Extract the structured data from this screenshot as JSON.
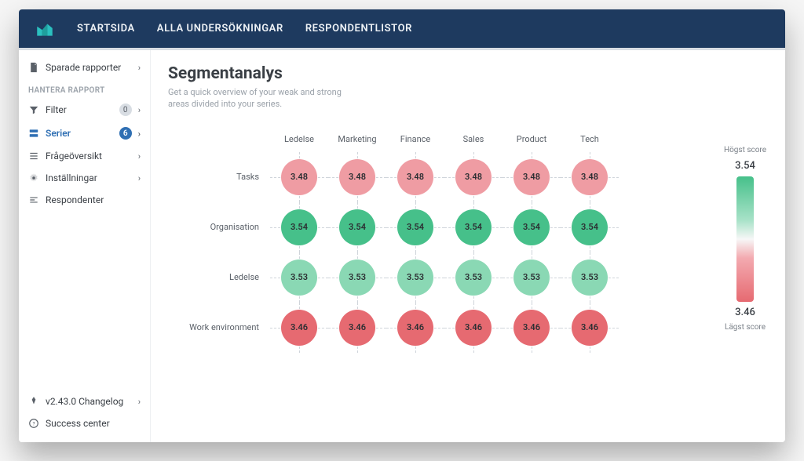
{
  "nav": {
    "items": [
      "STARTSIDA",
      "ALLA UNDERSÖKNINGAR",
      "RESPONDENTLISTOR"
    ]
  },
  "sidebar": {
    "saved_reports": "Sparade rapporter",
    "section_label": "HANTERA RAPPORT",
    "filter": {
      "label": "Filter",
      "count": "0"
    },
    "series": {
      "label": "Serier",
      "count": "6"
    },
    "overview": "Frågeöversikt",
    "settings": "Inställningar",
    "respondents": "Respondenter",
    "changelog": "v2.43.0 Changelog",
    "success": "Success center"
  },
  "page": {
    "title": "Segmentanalys",
    "subtitle": "Get a quick overview of your weak and strong areas divided into your series."
  },
  "chart_data": {
    "type": "heatmap",
    "columns": [
      "Ledelse",
      "Marketing",
      "Finance",
      "Sales",
      "Product",
      "Tech"
    ],
    "rows": [
      "Tasks",
      "Organisation",
      "Ledelse",
      "Work environment"
    ],
    "values": [
      [
        3.48,
        3.48,
        3.48,
        3.48,
        3.48,
        3.48
      ],
      [
        3.54,
        3.54,
        3.54,
        3.54,
        3.54,
        3.54
      ],
      [
        3.53,
        3.53,
        3.53,
        3.53,
        3.53,
        3.53
      ],
      [
        3.46,
        3.46,
        3.46,
        3.46,
        3.46,
        3.46
      ]
    ],
    "row_colors": [
      "#ef9ca3",
      "#46c08a",
      "#8ad8b4",
      "#e66a71"
    ],
    "scale": {
      "min": 3.46,
      "max": 3.54
    }
  },
  "legend": {
    "top_label": "Högst score",
    "top_value": "3.54",
    "bottom_value": "3.46",
    "bottom_label": "Lägst score"
  }
}
